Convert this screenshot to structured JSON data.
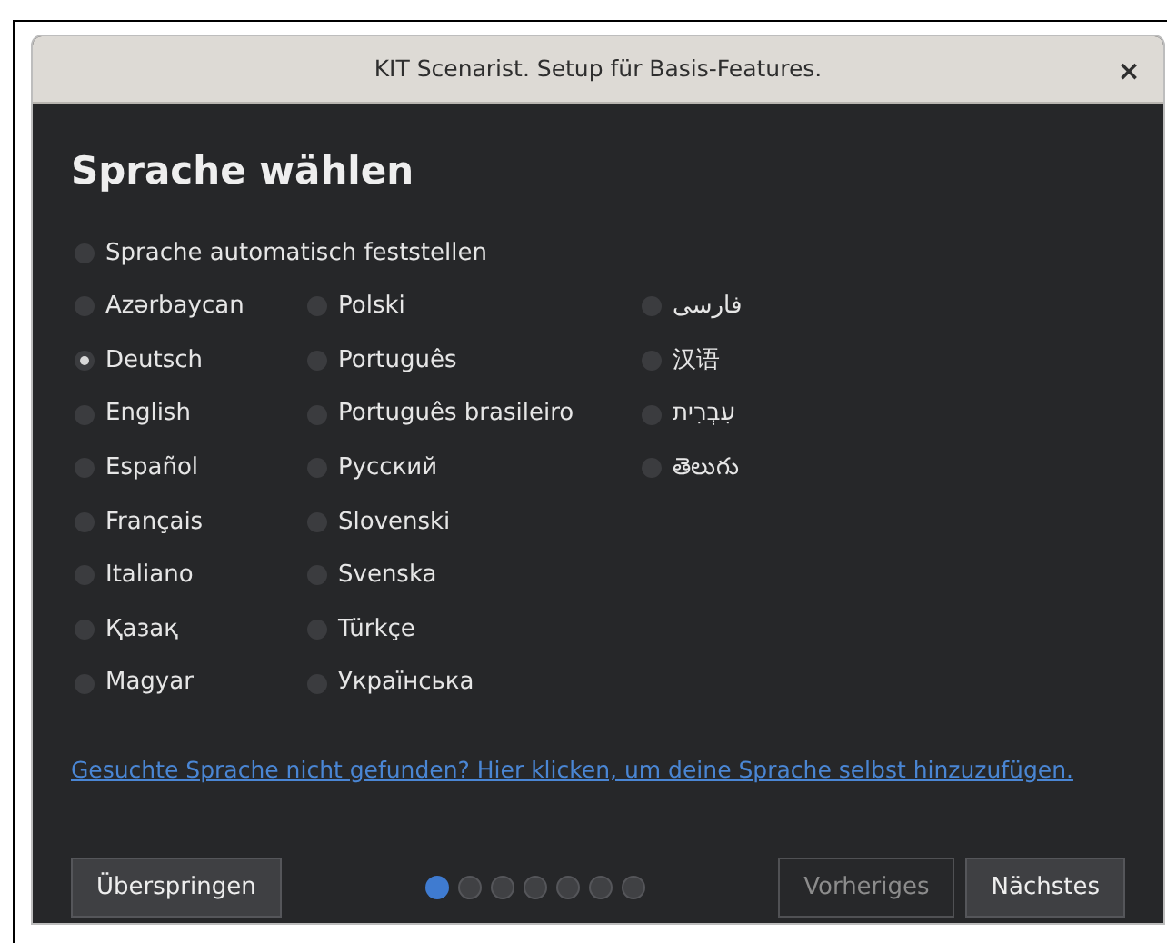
{
  "window": {
    "title": "KIT Scenarist. Setup für Basis-Features.",
    "close": "×"
  },
  "heading": "Sprache wählen",
  "auto_option": {
    "label": "Sprache automatisch feststellen",
    "selected": false
  },
  "language_columns": [
    [
      {
        "label": "Azərbaycan",
        "selected": false
      },
      {
        "label": "Deutsch",
        "selected": true
      },
      {
        "label": "English",
        "selected": false
      },
      {
        "label": "Español",
        "selected": false
      },
      {
        "label": "Français",
        "selected": false
      },
      {
        "label": "Italiano",
        "selected": false
      },
      {
        "label": "Қазақ",
        "selected": false
      },
      {
        "label": "Magyar",
        "selected": false
      }
    ],
    [
      {
        "label": "Polski",
        "selected": false
      },
      {
        "label": "Português",
        "selected": false
      },
      {
        "label": "Português brasileiro",
        "selected": false
      },
      {
        "label": "Русский",
        "selected": false
      },
      {
        "label": "Slovenski",
        "selected": false
      },
      {
        "label": "Svenska",
        "selected": false
      },
      {
        "label": "Türkçe",
        "selected": false
      },
      {
        "label": "Українська",
        "selected": false
      }
    ],
    [
      {
        "label": "فارسی",
        "selected": false
      },
      {
        "label": "汉语",
        "selected": false
      },
      {
        "label": "עִבְרִית",
        "selected": false
      },
      {
        "label": "తెలుగు",
        "selected": false
      }
    ]
  ],
  "help_link": "Gesuchte Sprache nicht gefunden? Hier klicken, um deine Sprache selbst hinzuzufügen.",
  "footer": {
    "skip_button": {
      "label": "Überspringen",
      "disabled": false
    },
    "steps": [
      {
        "selected": true
      },
      {
        "selected": false
      },
      {
        "selected": false
      },
      {
        "selected": false
      },
      {
        "selected": false
      },
      {
        "selected": false
      },
      {
        "selected": false
      }
    ],
    "back_button": {
      "label": "Vorheriges",
      "disabled": true
    },
    "next_button": {
      "label": "Nächstes",
      "disabled": false
    }
  }
}
